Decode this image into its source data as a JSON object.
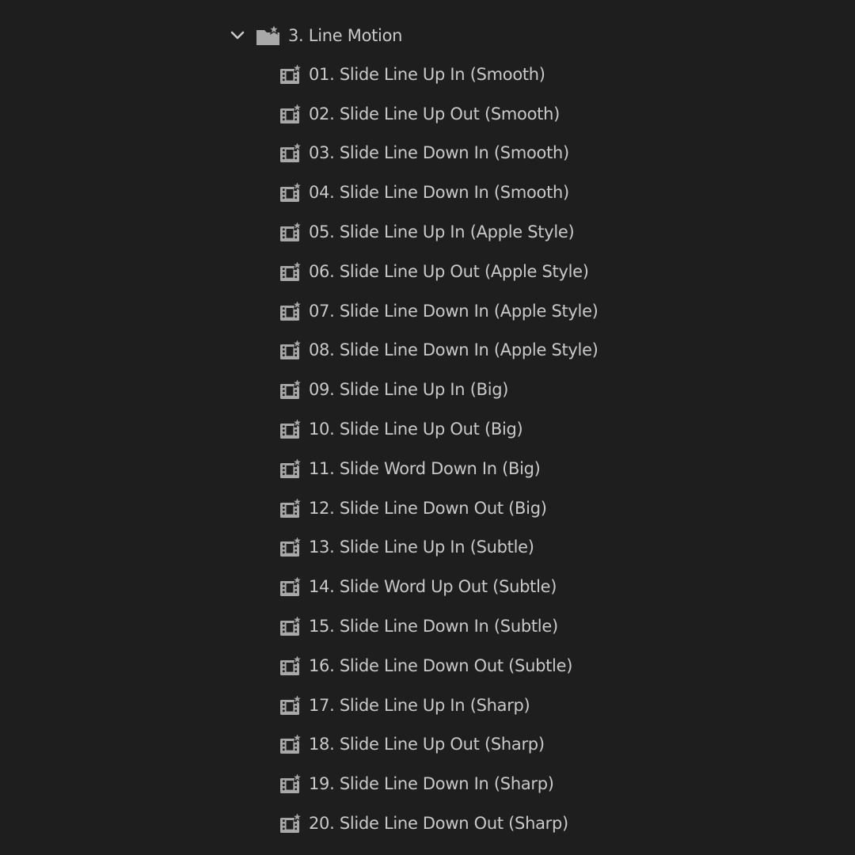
{
  "folder": {
    "label": "3. Line Motion",
    "expanded": true,
    "icon": "folder-star-icon"
  },
  "item_icon": "motion-graphics-template-icon",
  "colors": {
    "background": "#1e1e1e",
    "text": "#c9c9c9",
    "icon": "#a9a9a9"
  },
  "items": [
    {
      "label": "01. Slide Line Up In (Smooth)"
    },
    {
      "label": "02. Slide Line Up Out (Smooth)"
    },
    {
      "label": "03. Slide Line Down In (Smooth)"
    },
    {
      "label": "04. Slide Line Down In (Smooth)"
    },
    {
      "label": "05. Slide Line Up In (Apple Style)"
    },
    {
      "label": "06. Slide Line Up Out (Apple Style)"
    },
    {
      "label": "07. Slide Line Down In (Apple Style)"
    },
    {
      "label": "08. Slide Line Down In (Apple Style)"
    },
    {
      "label": "09. Slide Line Up In (Big)"
    },
    {
      "label": "10. Slide Line Up Out (Big)"
    },
    {
      "label": "11. Slide Word Down In (Big)"
    },
    {
      "label": "12. Slide Line Down Out (Big)"
    },
    {
      "label": "13. Slide Line Up In (Subtle)"
    },
    {
      "label": "14. Slide Word Up Out (Subtle)"
    },
    {
      "label": "15. Slide Line Down In (Subtle)"
    },
    {
      "label": "16. Slide Line Down Out (Subtle)"
    },
    {
      "label": "17. Slide Line Up In (Sharp)"
    },
    {
      "label": "18. Slide Line Up Out (Sharp)"
    },
    {
      "label": "19. Slide Line Down In (Sharp)"
    },
    {
      "label": "20. Slide Line Down Out (Sharp)"
    }
  ]
}
